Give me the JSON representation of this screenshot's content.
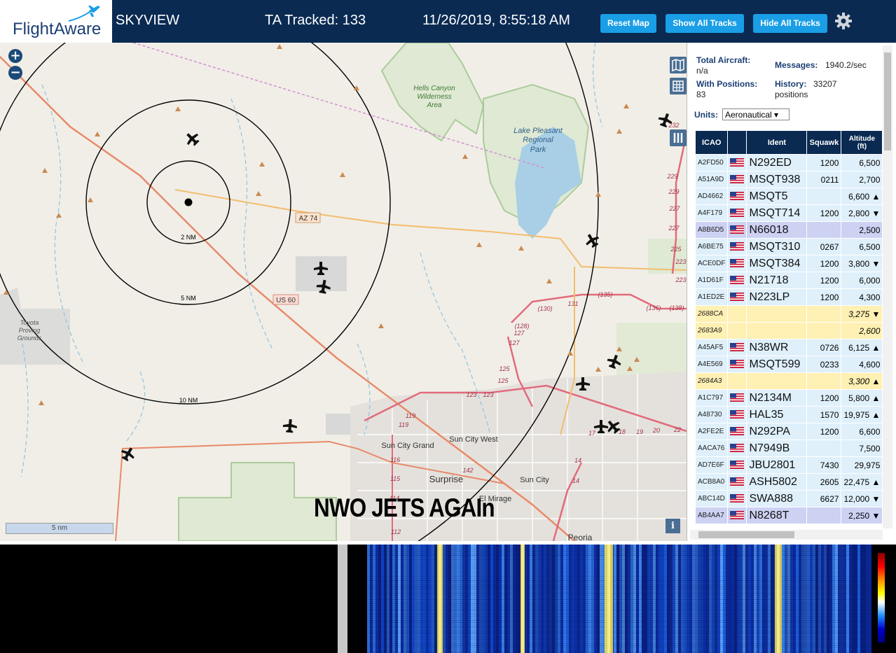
{
  "header": {
    "logo": "FlightAware",
    "app_name": "SKYVIEW",
    "tracked": "TA Tracked: 133",
    "datetime": "11/26/2019, 8:55:18 AM",
    "buttons": {
      "reset": "Reset Map",
      "show_all": "Show All Tracks",
      "hide_all": "Hide All Tracks"
    }
  },
  "map": {
    "zoom_in": "+",
    "zoom_out": "−",
    "labels": {
      "hells_canyon": [
        "Hells Canyon",
        "Wilderness",
        "Area"
      ],
      "lake_pleasant": [
        "Lake Pleasant",
        "Regional",
        "Park"
      ],
      "toyota": [
        "Toyota",
        "Proving",
        "Grounds"
      ],
      "az74": "AZ 74",
      "us60": "US 60",
      "ring2": "2 NM",
      "ring5": "5 NM",
      "ring10": "10 NM",
      "sun_city_grand": "Sun City Grand",
      "sun_city_west": "Sun City West",
      "sun_city": "Sun City",
      "surprise": "Surprise",
      "el_mirage": "El Mirage",
      "peoria": "Peoria"
    },
    "road_numbers": [
      "232",
      "229",
      "229",
      "227",
      "227",
      "225",
      "223",
      "223",
      "(135)",
      "(136)",
      "(138)",
      "(130)",
      "131",
      "(128)",
      "127",
      "127",
      "125",
      "125",
      "123",
      "123",
      "119",
      "119",
      "116",
      "115",
      "114",
      "112",
      "142",
      "14",
      "14",
      "17",
      "18",
      "19",
      "20",
      "22"
    ],
    "scale": "5 nm",
    "info": "i",
    "overlay_caption": "NWO JETS AGAIn"
  },
  "panel": {
    "total_label": "Total Aircraft:",
    "total_value": "n/a",
    "messages_label": "Messages:",
    "messages_value": "1940.2/sec",
    "positions_label": "With Positions:",
    "positions_value": "83",
    "history_label": "History:",
    "history_value": "33207",
    "history_unit": "positions",
    "units_label": "Units:",
    "units_value": "Aeronautical ▾",
    "columns": {
      "icao": "ICAO",
      "ident": "Ident",
      "squawk": "Squawk",
      "altitude": "Altitude",
      "altitude_unit": "(ft)"
    },
    "rows": [
      {
        "icao": "A2FD50",
        "ident": "N292ED",
        "squawk": "1200",
        "alt": "6,500",
        "flag": true,
        "style": "norm"
      },
      {
        "icao": "A51A9D",
        "ident": "MSQT938",
        "squawk": "0211",
        "alt": "2,700",
        "flag": true,
        "style": "norm"
      },
      {
        "icao": "AD4662",
        "ident": "MSQT5",
        "squawk": "",
        "alt": "6,600 ▲",
        "flag": true,
        "style": "norm"
      },
      {
        "icao": "A4F179",
        "ident": "MSQT714",
        "squawk": "1200",
        "alt": "2,800 ▼",
        "flag": true,
        "style": "norm"
      },
      {
        "icao": "A8B6D5",
        "ident": "N66018",
        "squawk": "",
        "alt": "2,500",
        "flag": true,
        "style": "sel"
      },
      {
        "icao": "A6BE75",
        "ident": "MSQT310",
        "squawk": "0267",
        "alt": "6,500",
        "flag": true,
        "style": "norm"
      },
      {
        "icao": "ACE0DF",
        "ident": "MSQT384",
        "squawk": "1200",
        "alt": "3,800 ▼",
        "flag": true,
        "style": "norm"
      },
      {
        "icao": "A1D61F",
        "ident": "N21718",
        "squawk": "1200",
        "alt": "6,000",
        "flag": true,
        "style": "norm"
      },
      {
        "icao": "A1ED2E",
        "ident": "N223LP",
        "squawk": "1200",
        "alt": "4,300",
        "flag": true,
        "style": "norm"
      },
      {
        "icao": "2688CA",
        "ident": "",
        "squawk": "",
        "alt": "3,275 ▼",
        "flag": false,
        "style": "noid"
      },
      {
        "icao": "2683A9",
        "ident": "",
        "squawk": "",
        "alt": "2,600",
        "flag": false,
        "style": "noid"
      },
      {
        "icao": "A45AF5",
        "ident": "N38WR",
        "squawk": "0726",
        "alt": "6,125 ▲",
        "flag": true,
        "style": "norm"
      },
      {
        "icao": "A4E569",
        "ident": "MSQT599",
        "squawk": "0233",
        "alt": "4,600",
        "flag": true,
        "style": "norm"
      },
      {
        "icao": "2684A3",
        "ident": "",
        "squawk": "",
        "alt": "3,300 ▲",
        "flag": false,
        "style": "noid"
      },
      {
        "icao": "A1C797",
        "ident": "N2134M",
        "squawk": "1200",
        "alt": "5,800 ▲",
        "flag": true,
        "style": "norm"
      },
      {
        "icao": "A48730",
        "ident": "HAL35",
        "squawk": "1570",
        "alt": "19,975 ▲",
        "flag": true,
        "style": "norm"
      },
      {
        "icao": "A2FE2E",
        "ident": "N292PA",
        "squawk": "1200",
        "alt": "6,600",
        "flag": true,
        "style": "norm"
      },
      {
        "icao": "AACA76",
        "ident": "N7949B",
        "squawk": "",
        "alt": "7,500",
        "flag": true,
        "style": "norm"
      },
      {
        "icao": "AD7E6F",
        "ident": "JBU2801",
        "squawk": "7430",
        "alt": "29,975",
        "flag": true,
        "style": "norm"
      },
      {
        "icao": "ACB8A0",
        "ident": "ASH5802",
        "squawk": "2605",
        "alt": "22,475 ▲",
        "flag": true,
        "style": "norm"
      },
      {
        "icao": "ABC14D",
        "ident": "SWA888",
        "squawk": "6627",
        "alt": "12,000 ▼",
        "flag": true,
        "style": "norm"
      },
      {
        "icao": "AB4AA7",
        "ident": "N8268T",
        "squawk": "",
        "alt": "2,250 ▼",
        "flag": true,
        "style": "sel"
      }
    ]
  },
  "colors": {
    "header_bg": "#0a2a52",
    "button_bg": "#1a9ee6",
    "row_normal": "#dff0fb",
    "row_selected": "#cdd2f3",
    "row_noident": "#fff0b3"
  }
}
